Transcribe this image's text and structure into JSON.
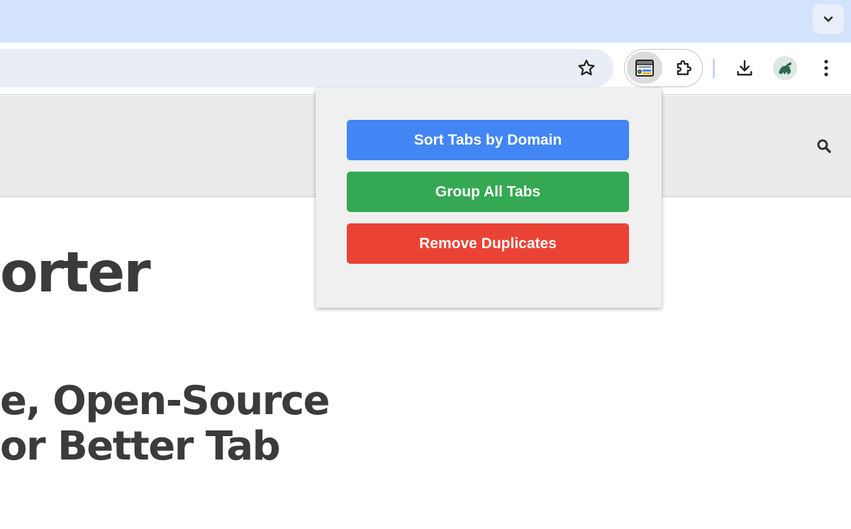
{
  "browser": {
    "tab_search_icon": "chevron-down-icon",
    "toolbar": {
      "bookmark_icon": "star-icon",
      "active_extension_icon": "tab-sorter-extension-icon",
      "extensions_icon": "puzzle-icon",
      "download_icon": "download-icon",
      "avatar_icon": "profile-avatar",
      "menu_icon": "kebab-menu-icon"
    }
  },
  "page": {
    "title": "orter",
    "subtitle_lines": [
      "e, Open-Source",
      "or Better Tab"
    ],
    "search_icon": "search-icon"
  },
  "popup": {
    "buttons": [
      {
        "label": "Sort Tabs by Domain",
        "color": "#4285f4"
      },
      {
        "label": "Group All Tabs",
        "color": "#34a853"
      },
      {
        "label": "Remove Duplicates",
        "color": "#ea4335"
      }
    ]
  },
  "colors": {
    "tabstrip": "#d3e3fd",
    "omnibox": "#e9eef6",
    "site_header": "#ebebeb",
    "heading_text": "#3b3b3b"
  }
}
